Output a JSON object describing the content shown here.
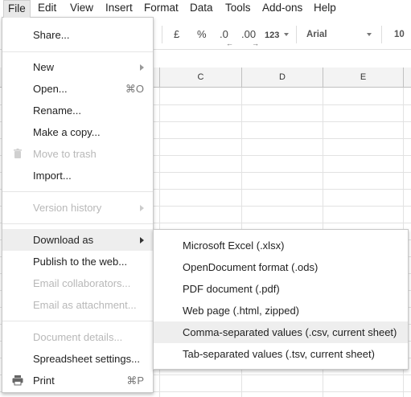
{
  "menubar": {
    "items": [
      "File",
      "Edit",
      "View",
      "Insert",
      "Format",
      "Data",
      "Tools",
      "Add-ons",
      "Help"
    ]
  },
  "toolbar": {
    "currency": "£",
    "percent": "%",
    "decrease_decimals": ".0",
    "increase_decimals": ".00",
    "more_formats": "123",
    "font": "Arial",
    "font_size": "10"
  },
  "grid": {
    "columns": [
      "C",
      "D",
      "E"
    ]
  },
  "file_menu": {
    "share": "Share...",
    "new": "New",
    "open": "Open...",
    "open_shortcut": "⌘O",
    "rename": "Rename...",
    "make_copy": "Make a copy...",
    "move_to_trash": "Move to trash",
    "import": "Import...",
    "version_history": "Version history",
    "download_as": "Download as",
    "publish": "Publish to the web...",
    "email_collaborators": "Email collaborators...",
    "email_attachment": "Email as attachment...",
    "document_details": "Document details...",
    "spreadsheet_settings": "Spreadsheet settings...",
    "print": "Print",
    "print_shortcut": "⌘P"
  },
  "download_menu": {
    "xlsx": "Microsoft Excel (.xlsx)",
    "ods": "OpenDocument format (.ods)",
    "pdf": "PDF document (.pdf)",
    "html": "Web page (.html, zipped)",
    "csv": "Comma-separated values (.csv, current sheet)",
    "tsv": "Tab-separated values (.tsv, current sheet)"
  }
}
